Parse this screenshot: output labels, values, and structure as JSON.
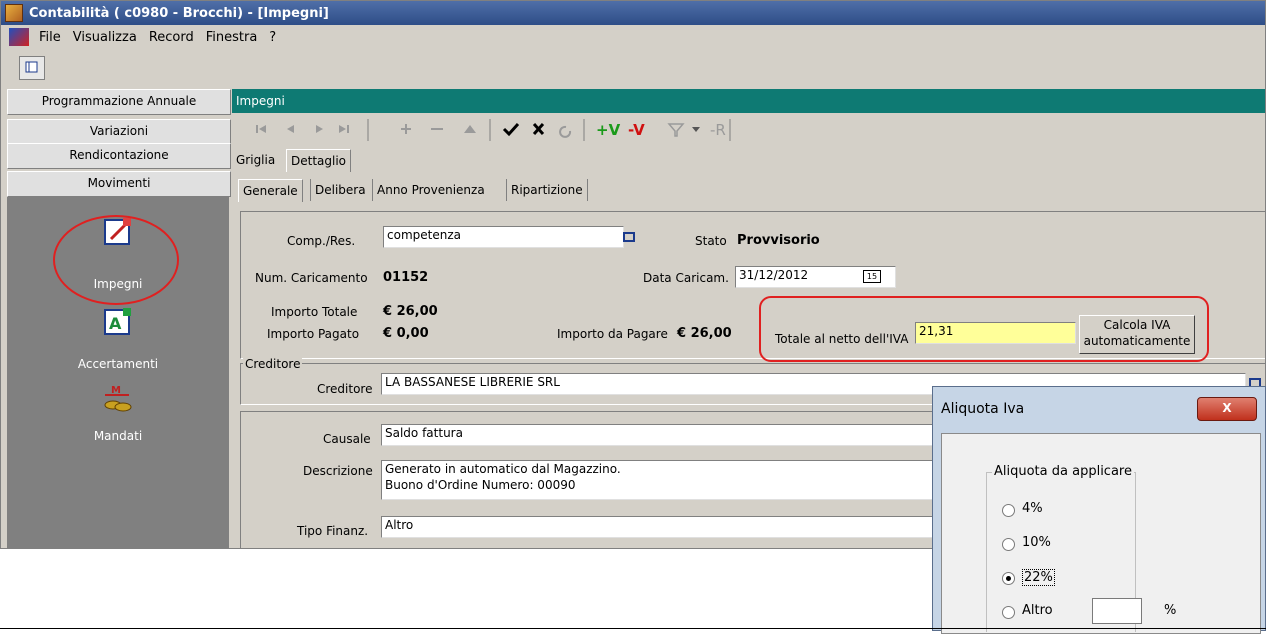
{
  "window": {
    "title": "Contabilità ( c0980 - Brocchi) - [Impegni]"
  },
  "menu": [
    "File",
    "Visualizza",
    "Record",
    "Finestra",
    "?"
  ],
  "sidebar": {
    "sections": [
      "Programmazione Annuale",
      "Variazioni",
      "Rendicontazione",
      "Movimenti"
    ],
    "items": [
      {
        "label": "Impegni",
        "icon": "impegni-icon"
      },
      {
        "label": "Accertamenti",
        "icon": "accertamenti-icon"
      },
      {
        "label": "Mandati",
        "icon": "mandati-icon"
      }
    ]
  },
  "content": {
    "header": "Impegni",
    "tabs": [
      "Griglia",
      "Dettaglio"
    ],
    "subtabs": [
      "Generale",
      "Delibera",
      "Anno Provenienza",
      "Ripartizione"
    ],
    "nav_buttons": [
      "first",
      "prev",
      "next",
      "last",
      "add",
      "delete",
      "up",
      "confirm",
      "cancel",
      "refresh",
      "+V",
      "-V",
      "filter",
      "-R"
    ],
    "fields": {
      "comp_res_label": "Comp./Res.",
      "comp_res_value": "competenza",
      "stato_label": "Stato",
      "stato_value": "Provvisorio",
      "num_caricamento_label": "Num. Caricamento",
      "num_caricamento_value": "01152",
      "data_caricam_label": "Data Caricam.",
      "data_caricam_value": "31/12/2012",
      "importo_totale_label": "Importo Totale",
      "importo_totale_value": "€ 26,00",
      "importo_pagato_label": "Importo Pagato",
      "importo_pagato_value": "€ 0,00",
      "importo_da_pagare_label": "Importo da Pagare",
      "importo_da_pagare_value": "€ 26,00",
      "totale_netto_label": "Totale al netto dell'IVA",
      "totale_netto_value": "21,31",
      "calcola_iva_label": "Calcola IVA automaticamente",
      "creditore_group": "Creditore",
      "creditore_label": "Creditore",
      "creditore_value": "LA BASSANESE LIBRERIE SRL",
      "causale_label": "Causale",
      "causale_value": "Saldo fattura",
      "descrizione_label": "Descrizione",
      "descrizione_line1": "Generato in automatico dal Magazzino.",
      "descrizione_line2": "Buono d'Ordine Numero: 00090",
      "tipo_finanz_label": "Tipo Finanz.",
      "tipo_finanz_value": "Altro"
    }
  },
  "dialog": {
    "title": "Aliquota Iva",
    "group_label": "Aliquota da applicare",
    "options": [
      {
        "label": "4%",
        "selected": false
      },
      {
        "label": "10%",
        "selected": false
      },
      {
        "label": "22%",
        "selected": true
      },
      {
        "label": "Altro",
        "selected": false
      }
    ],
    "percent_sign": "%",
    "close": "X"
  }
}
